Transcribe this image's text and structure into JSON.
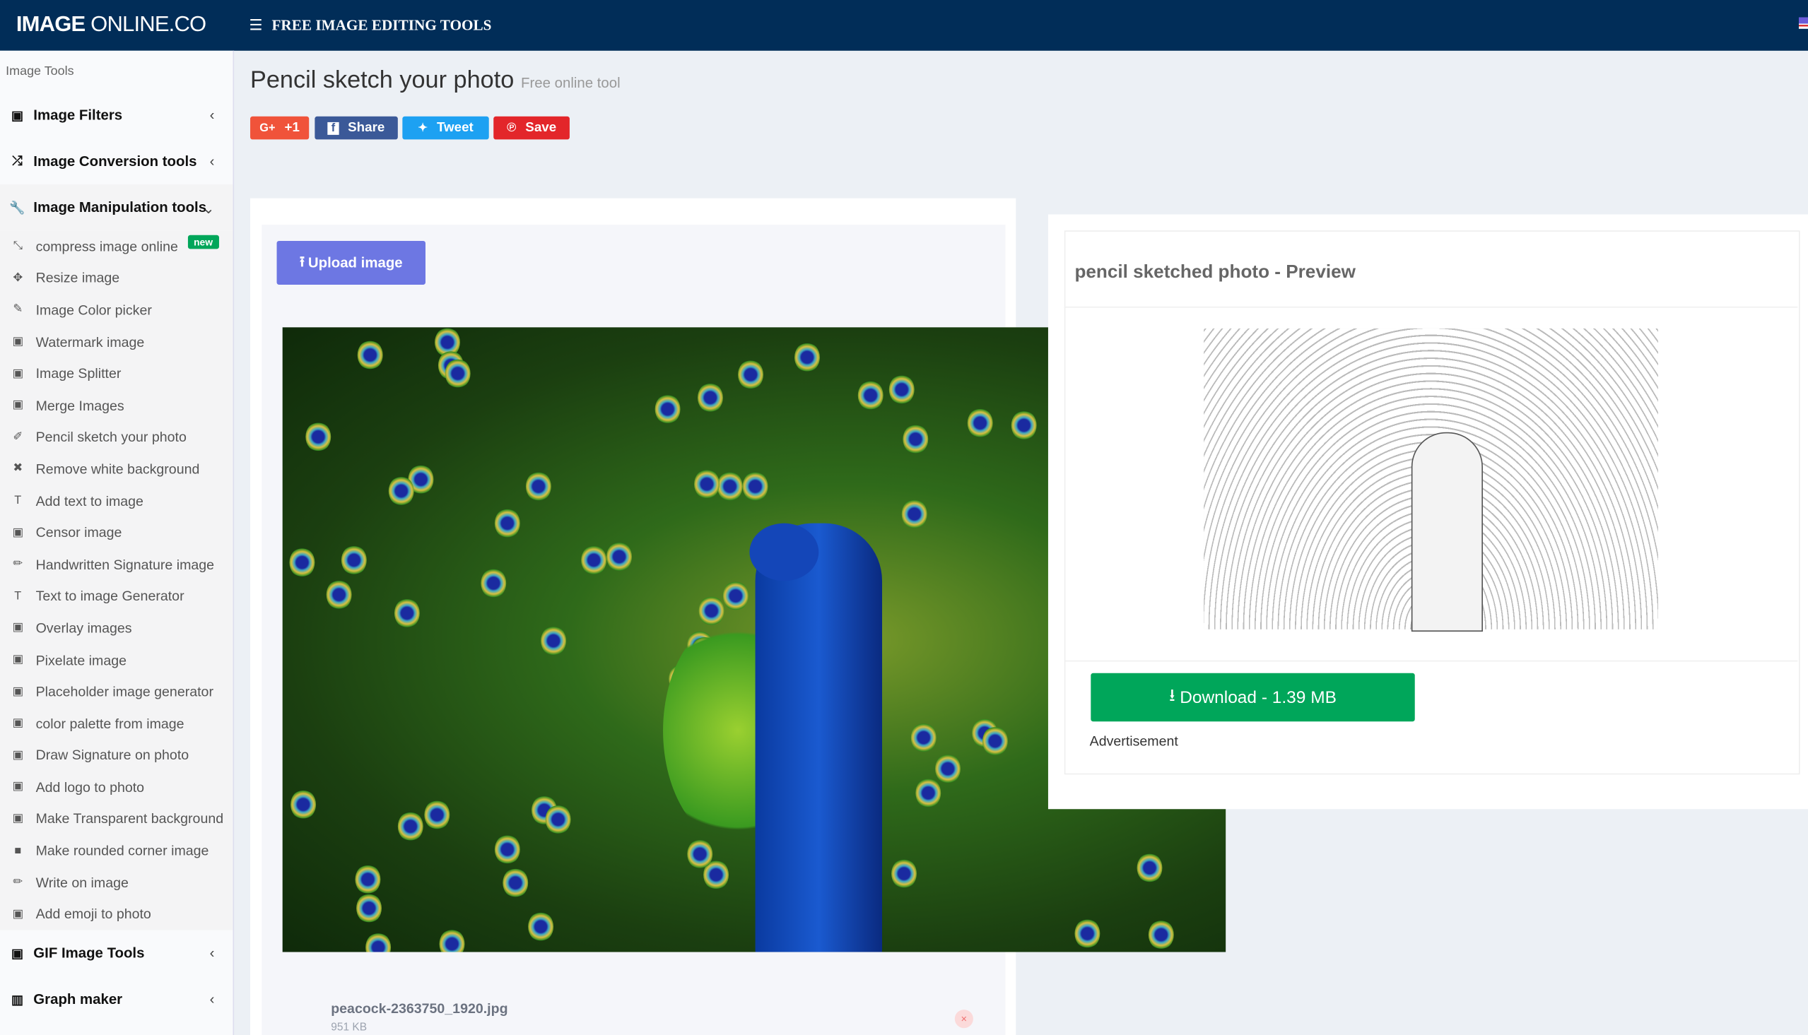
{
  "header": {
    "logo_bold": "IMAGE",
    "logo_rest": " ONLINE.CO",
    "menu_label": "FREE IMAGE EDITING TOOLS",
    "menu_icon": "hamburger-icon",
    "flag_icon": "us-flag-icon"
  },
  "sidebar": {
    "heading": "Image Tools",
    "sections_top": [
      {
        "label": "Image Filters",
        "icon": "image-icon"
      },
      {
        "label": "Image Conversion tools",
        "icon": "shuffle-icon"
      },
      {
        "label": "Image Manipulation tools",
        "icon": "wrench-icon"
      }
    ],
    "items": [
      {
        "label": "compress image online",
        "icon": "compress-icon",
        "badge": "new"
      },
      {
        "label": "Resize image",
        "icon": "arrows-icon"
      },
      {
        "label": "Image Color picker",
        "icon": "eyedropper-icon"
      },
      {
        "label": "Watermark image",
        "icon": "image-icon"
      },
      {
        "label": "Image Splitter",
        "icon": "image-icon"
      },
      {
        "label": "Merge Images",
        "icon": "image-icon"
      },
      {
        "label": "Pencil sketch your photo",
        "icon": "edit-icon"
      },
      {
        "label": "Remove white background",
        "icon": "x-icon"
      },
      {
        "label": "Add text to image",
        "icon": "text-icon"
      },
      {
        "label": "Censor image",
        "icon": "image-icon"
      },
      {
        "label": "Handwritten Signature image",
        "icon": "pencil-icon"
      },
      {
        "label": "Text to image Generator",
        "icon": "text-icon"
      },
      {
        "label": "Overlay images",
        "icon": "image-icon"
      },
      {
        "label": "Pixelate image",
        "icon": "image-icon"
      },
      {
        "label": "Placeholder image generator",
        "icon": "image-icon"
      },
      {
        "label": "color palette from image",
        "icon": "image-icon"
      },
      {
        "label": "Draw Signature on photo",
        "icon": "image-icon"
      },
      {
        "label": "Add logo to photo",
        "icon": "image-icon"
      },
      {
        "label": "Make Transparent background",
        "icon": "image-icon"
      },
      {
        "label": "Make rounded corner image",
        "icon": "square-icon"
      },
      {
        "label": "Write on image",
        "icon": "pencil-icon"
      },
      {
        "label": "Add emoji to photo",
        "icon": "image-icon"
      }
    ],
    "sections_bottom": [
      {
        "label": "GIF Image Tools",
        "icon": "image-icon"
      },
      {
        "label": "Graph maker",
        "icon": "bar-chart-icon"
      }
    ]
  },
  "page": {
    "title": "Pencil sketch your photo",
    "subtitle": "Free online tool"
  },
  "share": [
    {
      "label": "+1",
      "icon": "G+",
      "color": "#f0533a"
    },
    {
      "label": "Share",
      "icon": "f",
      "color": "#3b5998"
    },
    {
      "label": "Tweet",
      "icon": "🐦",
      "color": "#1da1f2"
    },
    {
      "label": "Save",
      "icon": "℗",
      "color": "#e3262a"
    }
  ],
  "upload": {
    "label": "Upload image",
    "icon": "upload-icon"
  },
  "file": {
    "name": "peacock-2363750_1920.jpg",
    "size": "951 KB",
    "remove_icon": "×"
  },
  "preview": {
    "title": "pencil sketched photo - Preview",
    "download_label": "Download - 1.39 MB",
    "download_icon": "download-icon",
    "ad_label": "Advertisement"
  },
  "colors": {
    "header": "#012d58",
    "upload": "#6d77e3",
    "download": "#00a65a"
  }
}
